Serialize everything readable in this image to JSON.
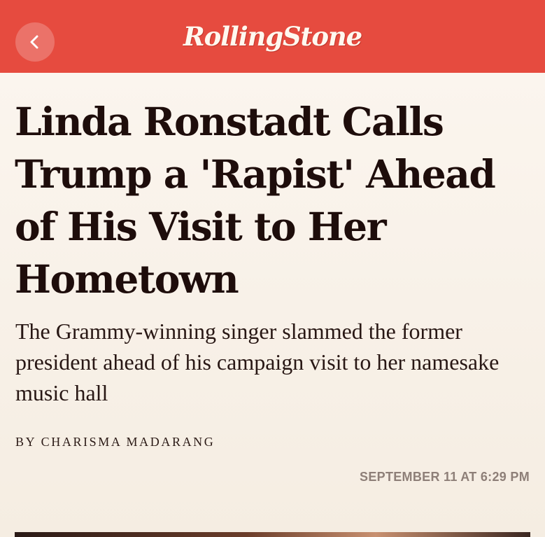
{
  "header": {
    "logo_text": "RollingStone",
    "back_icon": "chevron-left-icon",
    "brand_color": "#e64b3f"
  },
  "article": {
    "headline": "Linda Ronstadt Calls Trump a 'Rapist' Ahead of His Visit to Her Hometown",
    "dek": "The Grammy-winning singer slammed the former president ahead of his campaign visit to her namesake music hall",
    "byline": "BY CHARISMA MADARANG",
    "timestamp": "SEPTEMBER 11 AT 6:29 PM"
  }
}
